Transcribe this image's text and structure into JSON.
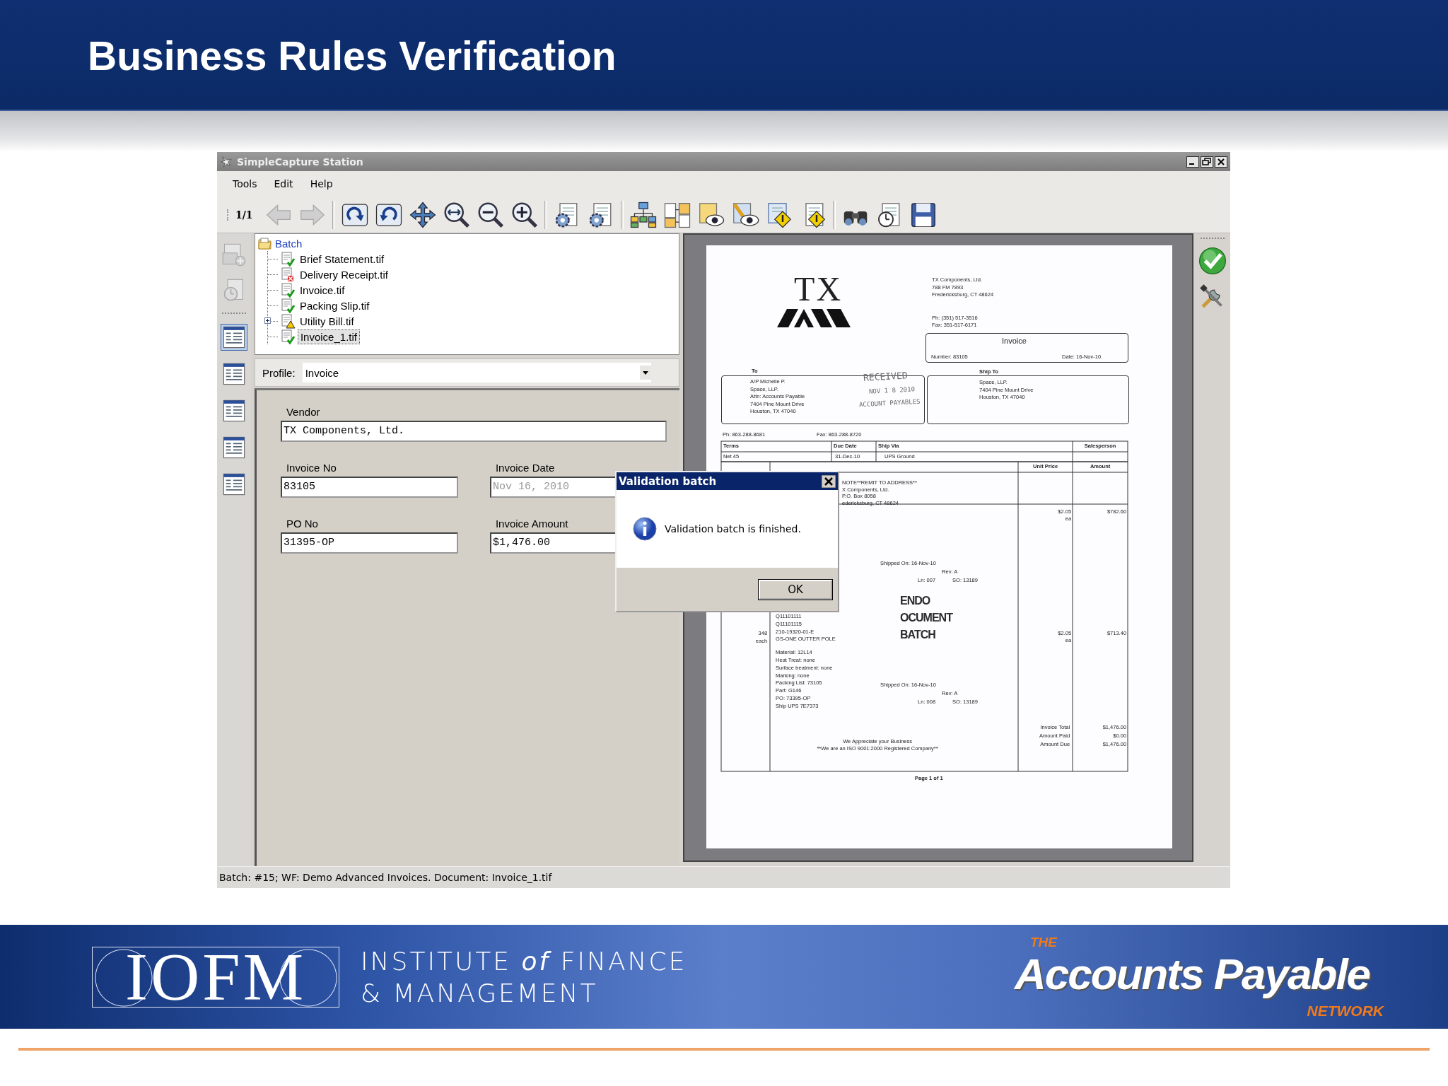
{
  "slide": {
    "title": "Business Rules Verification"
  },
  "window": {
    "title": "SimpleCapture Station"
  },
  "menu": [
    "Tools",
    "Edit",
    "Help"
  ],
  "toolbar": {
    "page_counter": "1/1"
  },
  "side_views": [
    {
      "selected": true
    },
    {
      "selected": false
    },
    {
      "selected": false
    },
    {
      "selected": false
    },
    {
      "selected": false
    }
  ],
  "tree": {
    "label": "Batch",
    "children": [
      {
        "label": "Brief Statement.tif",
        "kind": "ok",
        "collapsed": false,
        "selected": false
      },
      {
        "label": "Delivery Receipt.tif",
        "kind": "error",
        "collapsed": false,
        "selected": false
      },
      {
        "label": "Invoice.tif",
        "kind": "ok",
        "collapsed": false,
        "selected": false
      },
      {
        "label": "Packing Slip.tif",
        "kind": "ok",
        "collapsed": false,
        "selected": false
      },
      {
        "label": "Utility Bill.tif",
        "kind": "warning",
        "collapsed": true,
        "selected": false
      },
      {
        "label": "Invoice_1.tif",
        "kind": "ok",
        "collapsed": false,
        "selected": true
      }
    ]
  },
  "profile": {
    "label": "Profile:",
    "value": "Invoice"
  },
  "fields": [
    {
      "label": "Vendor",
      "value": "TX Components, Ltd.",
      "disabled": false
    },
    {
      "label": "Invoice No",
      "value": "83105",
      "disabled": false
    },
    {
      "label": "Invoice Date",
      "value": "Nov 16, 2010",
      "disabled": true
    },
    {
      "label": "PO No",
      "value": "31395-OP",
      "disabled": false
    },
    {
      "label": "Invoice Amount",
      "value": "$1,476.00",
      "disabled": false
    }
  ],
  "dialog": {
    "title": "Validation batch",
    "message": "Validation batch is finished.",
    "button": "OK"
  },
  "document": {
    "logo": "TX",
    "sender": [
      "TX Components, Ltd.",
      "788 FM 7893",
      "Fredericksburg, CT  48624"
    ],
    "phones": [
      "Ph:  (351) 517-3516",
      "Fax:  351-517-6171"
    ],
    "invoice_box": {
      "title": "Invoice",
      "number": "Number: 83105",
      "date": "Date:  16-Nov-10"
    },
    "to_label": "To",
    "to": [
      "A/P Michelle P.",
      "Space, LLP.",
      "Attn:  Accounts Payable",
      "7404 Pine Mount Drive",
      "Houston, TX 47040"
    ],
    "ship_to_label": "Ship To",
    "ship_to": [
      "Space, LLP.",
      "7404 Pine Mount Drive",
      "Houston, TX 47040"
    ],
    "received_stamp": [
      "RECEIVED",
      "NOV 1 8 2010",
      "ACCOUNT PAYABLES"
    ],
    "phone": "Ph: 863-288-8681",
    "fax": "Fax: 863-288-8720",
    "terms_headers": [
      "Terms",
      "Due Date",
      "Ship Via",
      "Salesperson"
    ],
    "terms_values": [
      "Net 45",
      "31-Dec-10",
      "UPS Ground"
    ],
    "item_headers": [
      "Unit Price",
      "Amount"
    ],
    "remit": [
      "NOTE**REMIT TO ADDRESS**",
      "X Components, Ltd.",
      "P.O. Box 8058",
      "edericksburg, CT  48624"
    ],
    "items": [
      {
        "shipping": [
          "Shipped On: 16-Nov-10",
          "Rev: A",
          "Ln: 007",
          "SO: 13189"
        ],
        "unit_price": [
          "$2.05",
          "ea"
        ],
        "amount": "$782.60"
      },
      {
        "quantity": [
          "348",
          "each"
        ],
        "description": [
          "Q11101111",
          "Q11101115",
          "210-19320-01-E",
          "GS-ONE OUTTER POLE",
          "Material: 12L14",
          "Heat Treat: none",
          "Surface treatment: none",
          "Marking: none",
          "Packing List: 73105",
          "Part: G146",
          "PO: 73395-OP",
          "Ship UPS 7E7373"
        ],
        "shipping": [
          "Shipped On: 16-Nov-10",
          "Rev: A",
          "Ln: 008",
          "SO: 13189"
        ],
        "unit_price": [
          "$2.05",
          "ea"
        ],
        "amount": "$713.40"
      }
    ],
    "vendor_stamp": [
      "ENDO",
      "OCUMENT",
      "BATCH"
    ],
    "closing": [
      "We Appreciate your Business",
      "**We are an ISO 9001:2000 Registered Company**"
    ],
    "totals": [
      {
        "label": "Invoice Total",
        "value": "$1,476.00"
      },
      {
        "label": "Amount Paid",
        "value": "$0.00"
      },
      {
        "label": "Amount Due",
        "value": "$1,476.00"
      }
    ],
    "page_note": "Page 1 of 1"
  },
  "status_bar": "Batch: #15; WF: Demo Advanced Invoices.  Document: Invoice_1.tif",
  "footer": {
    "logo_letters": "IOFM",
    "institute": [
      "INSTITUTE *of* FINANCE",
      "& MANAGEMENT"
    ],
    "network_the": "THE",
    "network_name": "Accounts Payable",
    "network_word": "NETWORK"
  }
}
